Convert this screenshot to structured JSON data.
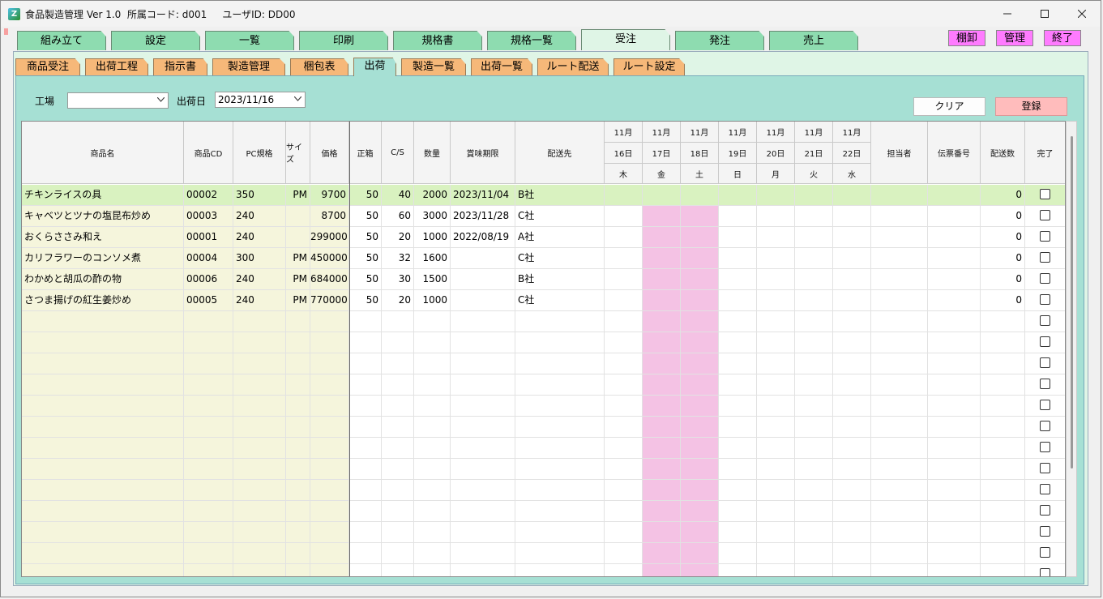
{
  "window": {
    "title": "食品製造管理 Ver 1.0  所属コード: d001     ユーザID: DD00",
    "icon_letter": "Z"
  },
  "top_tabs": [
    {
      "label": "組み立て",
      "active": false
    },
    {
      "label": "設定",
      "active": false
    },
    {
      "label": "一覧",
      "active": false
    },
    {
      "label": "印刷",
      "active": false
    },
    {
      "label": "規格書",
      "active": false
    },
    {
      "label": "規格一覧",
      "active": false
    },
    {
      "label": "受注",
      "active": true
    },
    {
      "label": "発注",
      "active": false
    },
    {
      "label": "売上",
      "active": false
    }
  ],
  "side_buttons": [
    {
      "label": "棚卸"
    },
    {
      "label": "管理"
    },
    {
      "label": "終了"
    }
  ],
  "sub_tabs": [
    {
      "label": "商品受注",
      "active": false
    },
    {
      "label": "出荷工程",
      "active": false
    },
    {
      "label": "指示書",
      "active": false
    },
    {
      "label": "製造管理",
      "active": false
    },
    {
      "label": "梱包表",
      "active": false
    },
    {
      "label": "出荷",
      "active": true
    },
    {
      "label": "製造一覧",
      "active": false
    },
    {
      "label": "出荷一覧",
      "active": false
    },
    {
      "label": "ルート配送",
      "active": false
    },
    {
      "label": "ルート設定",
      "active": false
    }
  ],
  "filters": {
    "factory_label": "工場",
    "factory_value": "",
    "ship_date_label": "出荷日",
    "ship_date_value": "2023/11/16"
  },
  "buttons": {
    "clear": "クリア",
    "register": "登録"
  },
  "table": {
    "headers": {
      "name": "商品名",
      "code": "商品CD",
      "pc": "PC規格",
      "size": "サイズ",
      "price": "価格",
      "box": "正箱",
      "cs": "C/S",
      "qty": "数量",
      "expiry": "賞味期限",
      "dest": "配送先",
      "person": "担当者",
      "slip": "伝票番号",
      "shipcount": "配送数",
      "done": "完了"
    },
    "days": [
      {
        "month": "11月",
        "day": "16日",
        "weekday": "木"
      },
      {
        "month": "11月",
        "day": "17日",
        "weekday": "金"
      },
      {
        "month": "11月",
        "day": "18日",
        "weekday": "土"
      },
      {
        "month": "11月",
        "day": "19日",
        "weekday": "日"
      },
      {
        "month": "11月",
        "day": "20日",
        "weekday": "月"
      },
      {
        "month": "11月",
        "day": "21日",
        "weekday": "火"
      },
      {
        "month": "11月",
        "day": "22日",
        "weekday": "水"
      }
    ],
    "rows": [
      {
        "name": "チキンライスの具",
        "code": "00002",
        "pc": "350",
        "size": "PM",
        "price": "9700",
        "box": "50",
        "cs": "40",
        "qty": "2000",
        "expiry": "2023/11/04",
        "dest": "B社",
        "shipcount": "0",
        "selected": true
      },
      {
        "name": "キャベツとツナの塩昆布炒め",
        "code": "00003",
        "pc": "240",
        "size": "",
        "price": "8700",
        "box": "50",
        "cs": "60",
        "qty": "3000",
        "expiry": "2023/11/28",
        "dest": "C社",
        "shipcount": "0",
        "selected": false
      },
      {
        "name": "おくらささみ和え",
        "code": "00001",
        "pc": "240",
        "size": "",
        "price": "299000",
        "box": "50",
        "cs": "20",
        "qty": "1000",
        "expiry": "2022/08/19",
        "dest": "A社",
        "shipcount": "0",
        "selected": false
      },
      {
        "name": "カリフラワーのコンソメ煮",
        "code": "00004",
        "pc": "300",
        "size": "PM",
        "price": "450000",
        "box": "50",
        "cs": "32",
        "qty": "1600",
        "expiry": "",
        "dest": "C社",
        "shipcount": "0",
        "selected": false
      },
      {
        "name": "わかめと胡瓜の酢の物",
        "code": "00006",
        "pc": "240",
        "size": "PM",
        "price": "684000",
        "box": "50",
        "cs": "30",
        "qty": "1500",
        "expiry": "",
        "dest": "B社",
        "shipcount": "0",
        "selected": false
      },
      {
        "name": "さつま揚げの紅生姜炒め",
        "code": "00005",
        "pc": "240",
        "size": "PM",
        "price": "770000",
        "box": "50",
        "cs": "20",
        "qty": "1000",
        "expiry": "",
        "dest": "C社",
        "shipcount": "0",
        "selected": false
      }
    ],
    "empty_rows": 13
  },
  "colors": {
    "top_tab": "#8edcb0",
    "top_tab_active": "#dff5e6",
    "sub_tab": "#f6b879",
    "sub_tab_active": "#a6e0d4",
    "panel": "#a6e0d4",
    "left_columns_bg": "#f5f5dc",
    "selected_row": "#d9f2c0",
    "weekend_col": "#f4c2e4",
    "pink_button": "#ff7bff",
    "register_button": "#ffbcbc"
  }
}
